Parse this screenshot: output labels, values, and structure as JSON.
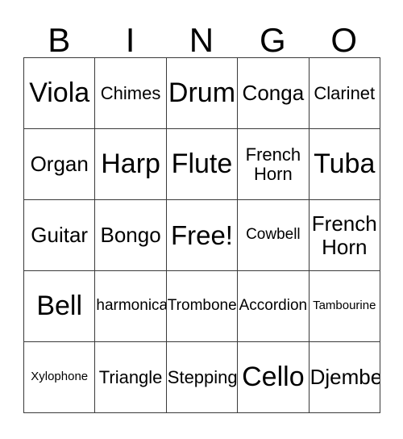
{
  "card": {
    "title_letters": [
      "B",
      "I",
      "N",
      "G",
      "O"
    ],
    "colors": {
      "background": "#ffffff",
      "text": "#000000",
      "grid_line": "#3a3a3a"
    },
    "rows": [
      [
        {
          "label": "Viola",
          "size": "xl"
        },
        {
          "label": "Chimes",
          "size": "sm"
        },
        {
          "label": "Drum",
          "size": "xl"
        },
        {
          "label": "Conga",
          "size": "md"
        },
        {
          "label": "Clarinet",
          "size": "sm"
        }
      ],
      [
        {
          "label": "Organ",
          "size": "md"
        },
        {
          "label": "Harp",
          "size": "xl"
        },
        {
          "label": "Flute",
          "size": "xl"
        },
        {
          "label": "French Horn",
          "size": "sm"
        },
        {
          "label": "Tuba",
          "size": "xl"
        }
      ],
      [
        {
          "label": "Guitar",
          "size": "md"
        },
        {
          "label": "Bongo",
          "size": "md"
        },
        {
          "label": "Free!",
          "size": "free"
        },
        {
          "label": "Cowbell",
          "size": "xs"
        },
        {
          "label": "French Horn",
          "size": "md"
        }
      ],
      [
        {
          "label": "Bell",
          "size": "xl"
        },
        {
          "label": "harmonica",
          "size": "xs"
        },
        {
          "label": "Trombone",
          "size": "xs"
        },
        {
          "label": "Accordion",
          "size": "xs"
        },
        {
          "label": "Tambourine",
          "size": "xxs"
        }
      ],
      [
        {
          "label": "Xylophone",
          "size": "xxs"
        },
        {
          "label": "Triangle",
          "size": "sm"
        },
        {
          "label": "Stepping",
          "size": "sm"
        },
        {
          "label": "Cello",
          "size": "xl"
        },
        {
          "label": "Djembe",
          "size": "md"
        }
      ]
    ]
  }
}
